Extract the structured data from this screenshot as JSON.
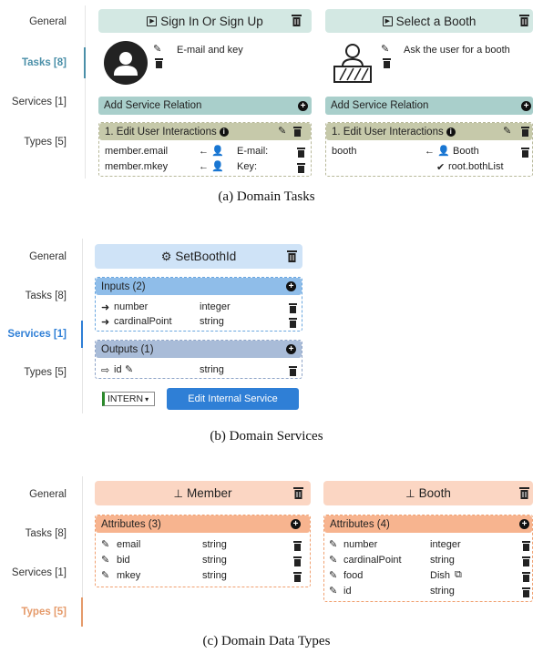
{
  "panel_a": {
    "nav": {
      "general": "General",
      "tasks": "Tasks [8]",
      "services": "Services [1]",
      "types": "Types [5]"
    },
    "task1": {
      "title": "Sign In Or Sign Up",
      "description": "E-mail and key",
      "add_service": "Add Service Relation",
      "interaction": "1. Edit User Interactions",
      "rows": [
        {
          "left": "member.email",
          "arrow": "←",
          "right": "E-mail:"
        },
        {
          "left": "member.mkey",
          "arrow": "←",
          "right": "Key:"
        }
      ]
    },
    "task2": {
      "title": "Select a Booth",
      "description": "Ask the user for a booth",
      "add_service": "Add Service Relation",
      "interaction": "1. Edit User Interactions",
      "rows": [
        {
          "left": "booth",
          "arrow": "←",
          "right": "Booth"
        }
      ],
      "extra": "root.bothList"
    },
    "caption": "(a) Domain Tasks"
  },
  "panel_b": {
    "nav": {
      "general": "General",
      "tasks": "Tasks [8]",
      "services": "Services [1]",
      "types": "Types [5]"
    },
    "service": {
      "title": "SetBoothId",
      "inputs_label": "Inputs (2)",
      "inputs": [
        {
          "name": "number",
          "type": "integer"
        },
        {
          "name": "cardinalPoint",
          "type": "string"
        }
      ],
      "outputs_label": "Outputs (1)",
      "outputs": [
        {
          "name": "id",
          "type": "string"
        }
      ],
      "select_value": "INTERN",
      "edit_button": "Edit Internal Service"
    },
    "caption": "(b) Domain Services"
  },
  "panel_c": {
    "nav": {
      "general": "General",
      "tasks": "Tasks [8]",
      "services": "Services [1]",
      "types": "Types [5]"
    },
    "type1": {
      "title": "Member",
      "attrs_label": "Attributes (3)",
      "attrs": [
        {
          "name": "email",
          "type": "string"
        },
        {
          "name": "bid",
          "type": "string"
        },
        {
          "name": "mkey",
          "type": "string"
        }
      ]
    },
    "type2": {
      "title": "Booth",
      "attrs_label": "Attributes (4)",
      "attrs": [
        {
          "name": "number",
          "type": "integer"
        },
        {
          "name": "cardinalPoint",
          "type": "string"
        },
        {
          "name": "food",
          "type": "Dish"
        },
        {
          "name": "id",
          "type": "string"
        }
      ]
    },
    "caption": "(c) Domain Data Types"
  },
  "colors": {
    "task_header": "#d3e8e3",
    "task_section": "#a9cfcb",
    "interaction": "#c6c9aa",
    "service_header": "#cfe3f7",
    "inputs": "#8fbde9",
    "outputs": "#a9bcd8",
    "type_header": "#fbd6c3",
    "attrs": "#f7b48f"
  }
}
